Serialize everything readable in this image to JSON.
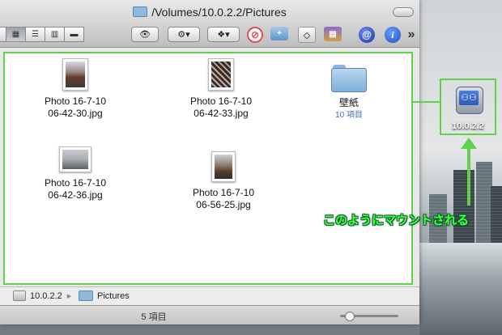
{
  "window": {
    "title": "/Volumes/10.0.2.2/Pictures",
    "toolbar": {
      "action_label": "⚙▾",
      "dropbox_label": "❖▾",
      "more_label": "»"
    }
  },
  "files": [
    {
      "name_line1": "Photo 16-7-10",
      "name_line2": "06-42-30.jpg"
    },
    {
      "name_line1": "Photo 16-7-10",
      "name_line2": "06-42-33.jpg"
    },
    {
      "name_line1": "Photo 16-7-10",
      "name_line2": "06-42-36.jpg"
    },
    {
      "name_line1": "Photo 16-7-10",
      "name_line2": "06-56-25.jpg"
    }
  ],
  "folder": {
    "name": "壁紙",
    "count": "10 項目"
  },
  "pathbar": {
    "server": "10.0.2.2",
    "folder": "Pictures"
  },
  "status": {
    "items": "5 項目",
    "zoom_fraction": 0.15
  },
  "desktop": {
    "server_label": "10.0.2.2",
    "caption": "このようにマウントされる"
  },
  "colors": {
    "highlight": "#5fd24a",
    "caption": "#4cff3a"
  }
}
